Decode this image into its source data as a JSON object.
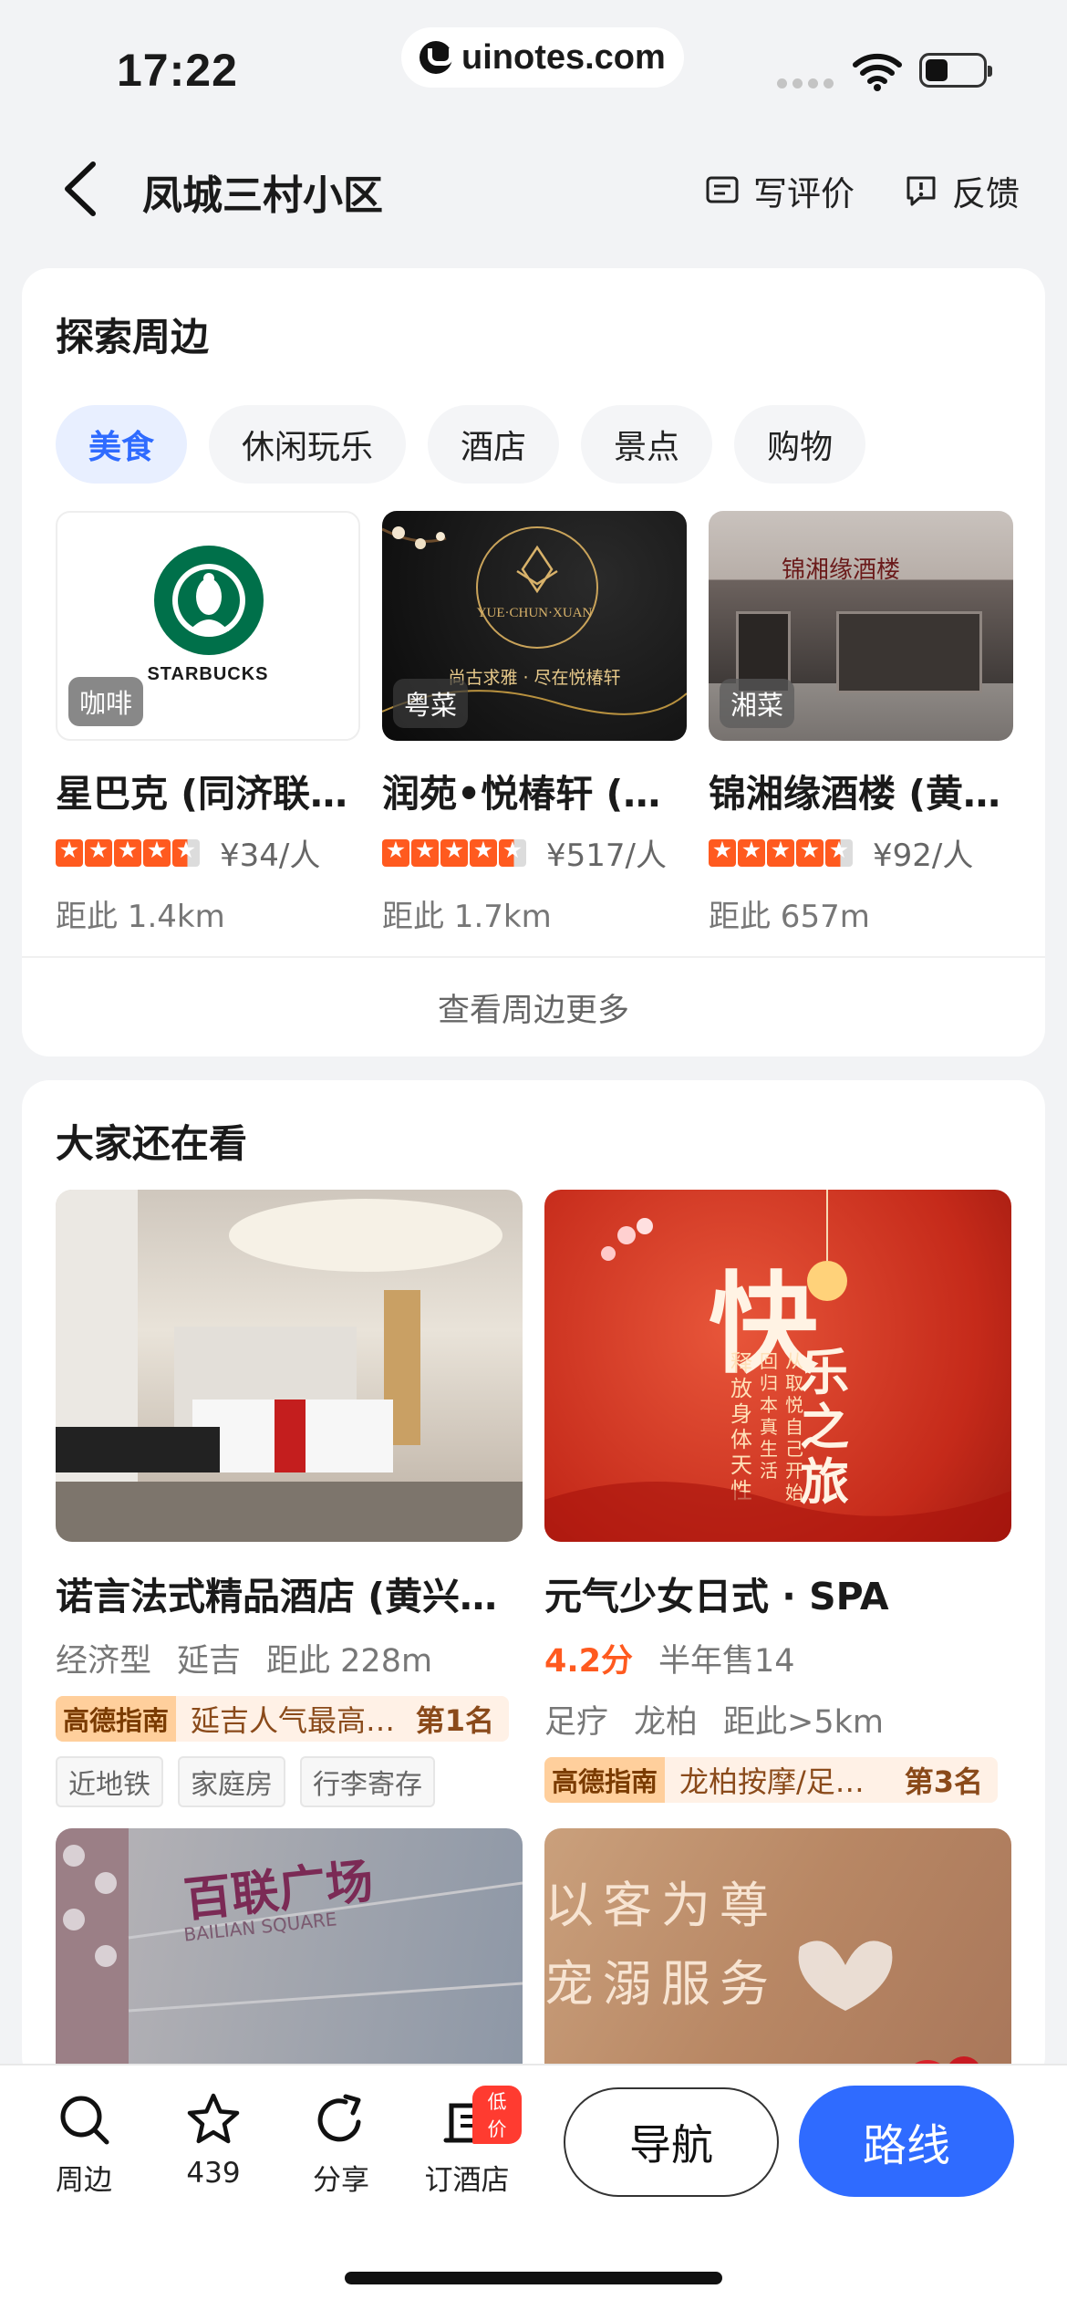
{
  "status_bar": {
    "time": "17:22",
    "watermark": "uinotes.com"
  },
  "header": {
    "title": "凤城三村小区",
    "write_review": "写评价",
    "feedback": "反馈"
  },
  "explore": {
    "title": "探索周边",
    "chips": [
      "美食",
      "休闲玩乐",
      "酒店",
      "景点",
      "购物"
    ],
    "active_chip": "美食",
    "pois": [
      {
        "category": "咖啡",
        "name": "星巴克 (同济联…",
        "rating": 4.5,
        "price": "¥34/人",
        "distance": "距此 1.4km",
        "logo_text": "STARBUCKS"
      },
      {
        "category": "粤菜",
        "name": "润苑•悦椿轩 (…",
        "rating": 4.5,
        "price": "¥517/人",
        "distance": "距此 1.7km",
        "logo_text": "YUE·CHUN·XUAN",
        "slogan": "尚古求雅 · 尽在悦椿轩"
      },
      {
        "category": "湘菜",
        "name": "锦湘缘酒楼 (黄…",
        "rating": 4.5,
        "price": "¥92/人",
        "distance": "距此 657m",
        "sign_text": "锦湘缘酒楼"
      }
    ],
    "see_more": "查看周边更多"
  },
  "recommend": {
    "title": "大家还在看",
    "items": [
      {
        "name": "诺言法式精品酒店 (黄兴…",
        "line1": [
          "经济型",
          "延吉",
          "距此 228m"
        ],
        "rank_badge": "高德指南",
        "rank_text": "延吉人气最高…",
        "rank_no": "第1名",
        "tags": [
          "近地铁",
          "家庭房",
          "行李寄存"
        ]
      },
      {
        "name": "元气少女日式 · SPA",
        "score": "4.2分",
        "sold": "半年售14",
        "line2": [
          "足疗",
          "龙柏",
          "距此>5km"
        ],
        "rank_badge": "高德指南",
        "rank_text": "龙柏按摩/足…",
        "rank_no": "第3名",
        "poster_big": "快",
        "poster_title": "乐之旅",
        "poster_sub1": "释放身体天性",
        "poster_sub2": "回归本真生活",
        "poster_sub3": "从取悦自己开始"
      },
      {
        "name": "",
        "sign_text": "百联广场",
        "sign_en": "BAILIAN SQUARE"
      },
      {
        "name": "",
        "sign_text": "以客为尊",
        "sign_text2": "宠溺服务"
      }
    ]
  },
  "bottom_bar": {
    "tabs": [
      {
        "label": "周边",
        "icon": "search-icon"
      },
      {
        "label": "439",
        "icon": "star-icon"
      },
      {
        "label": "分享",
        "icon": "share-icon"
      },
      {
        "label": "订酒店",
        "icon": "hotel-icon",
        "badge": "低价"
      }
    ],
    "navigate": "导航",
    "route": "路线",
    "accent_color": "#2f6bff"
  }
}
